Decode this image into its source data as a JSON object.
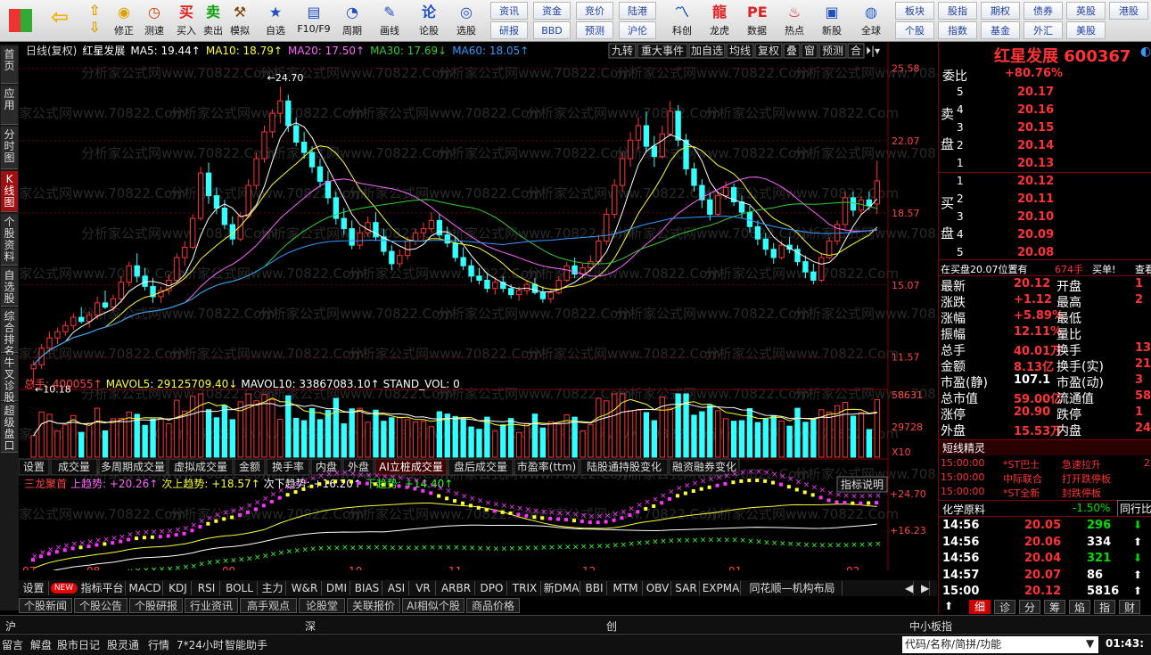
{
  "toolbar": {
    "buttons": [
      "修正",
      "测速",
      "买入",
      "卖出",
      "模拟",
      "自选",
      "F10/F9",
      "周期",
      "画线",
      "论股",
      "选股"
    ],
    "small_top": [
      "资讯",
      "资金",
      "竞价",
      "陆港"
    ],
    "small_bottom": [
      "研报",
      "BBD",
      "预测",
      "沪伦"
    ],
    "big": [
      "科创",
      "龙虎",
      "数据",
      "热点",
      "新股"
    ],
    "globe": "全球",
    "right_top": [
      "板块",
      "股指",
      "期权",
      "债券",
      "英股",
      "港股"
    ],
    "right_bottom": [
      "个股",
      "指数",
      "基金",
      "外汇",
      "美股"
    ]
  },
  "left_tabs": [
    "首页",
    "应用",
    "分时图",
    "K线图",
    "个股资料",
    "自选股",
    "综合排名",
    "牛叉诊股",
    "超级盘口"
  ],
  "main": {
    "header": {
      "period": "日线(复权)",
      "stock": "红星发展",
      "ma5": "MA5: 19.44↑",
      "ma10": "MA10: 18.79↑",
      "ma20": "MA20: 17.50↑",
      "ma30": "MA30: 17.69↓",
      "ma60": "MA60: 18.05↑"
    },
    "buttons": [
      "九转",
      "重大事件",
      "加自选",
      "均线",
      "复权",
      "叠",
      "窗",
      "预测",
      "合"
    ],
    "price_axis": [
      "25.58",
      "22.07",
      "18.57",
      "15.07",
      "11.57"
    ],
    "high_label": "24.70",
    "low_label": "10.18",
    "vol_header": {
      "total": "总手: 400055↑",
      "mavol5": "MAVOL5: 29125709.40↓",
      "mavol10": "MAVOL10: 33867083.10↑",
      "stand": "STAND_VOL: 0"
    },
    "vol_axis": [
      "58631",
      "29728",
      "X10"
    ],
    "vol_tabs": [
      "设置",
      "成交量",
      "多周期成交量",
      "虚拟成交量",
      "金额",
      "换手率",
      "内盘",
      "外盘",
      "AI立桩成交量",
      "盘后成交量",
      "市盈率(ttm)",
      "陆股通持股变化",
      "融资融券变化"
    ],
    "ind_header": {
      "name": "三龙聚首",
      "up": "上趋势: +20.26↑",
      "sub_up": "次上趋势: +18.57↑",
      "sub_down": "次下趋势: +16.20↑",
      "down": "下趋势: +14.40↑"
    },
    "ind_axis": [
      "+24.70",
      "+16.23"
    ],
    "ind_button": "指标说明",
    "months": [
      "07",
      "08",
      "09",
      "10",
      "11",
      "12",
      "01",
      "02"
    ]
  },
  "bottom_tabs": [
    "设置",
    "NEW",
    "指标平台",
    "MACD",
    "KDJ",
    "RSI",
    "BOLL",
    "主力",
    "W&R",
    "DMI",
    "BIAS",
    "ASI",
    "VR",
    "ARBR",
    "DPO",
    "TRIX",
    "新DMA",
    "BBI",
    "MTM",
    "OBV",
    "SAR",
    "EXPMA",
    "同花顺—机构布局"
  ],
  "news_tabs": [
    "个股新闻",
    "个股公告",
    "个股研报",
    "行业资讯",
    "高手观点",
    "论股堂",
    "关联报价",
    "AI相似个股",
    "商品价格"
  ],
  "market": [
    "沪",
    "深",
    "创",
    "中小板指"
  ],
  "status": {
    "items": [
      "留言",
      "解盘",
      "股市日记",
      "股灵通",
      "行情",
      "7*24小时",
      "智能助手"
    ],
    "search_placeholder": "代码/名称/简拼/功能",
    "time": "01:43:"
  },
  "quote": {
    "title": "红星发展 600367",
    "weibi_label": "委比",
    "weibi": "+80.76%",
    "sell_label": "卖盘",
    "buy_label": "买盘",
    "asks": [
      {
        "n": "5",
        "p": "20.17"
      },
      {
        "n": "4",
        "p": "20.16"
      },
      {
        "n": "3",
        "p": "20.15"
      },
      {
        "n": "2",
        "p": "20.14"
      },
      {
        "n": "1",
        "p": "20.13"
      }
    ],
    "bids": [
      {
        "n": "1",
        "p": "20.12"
      },
      {
        "n": "2",
        "p": "20.11"
      },
      {
        "n": "3",
        "p": "20.10"
      },
      {
        "n": "4",
        "p": "20.09"
      },
      {
        "n": "5",
        "p": "20.08"
      }
    ],
    "notice": "在买盘20.07位置有",
    "notice_amt": "674手",
    "notice_tag": "买单!",
    "notice_link": "查看",
    "stats": [
      {
        "l": "最新",
        "v": "20.12",
        "l2": "开盘",
        "v2": "1"
      },
      {
        "l": "涨跌",
        "v": "+1.12",
        "l2": "最高",
        "v2": "2"
      },
      {
        "l": "涨幅",
        "v": "+5.89%",
        "l2": "最低",
        "v2": ""
      },
      {
        "l": "振幅",
        "v": "12.11%",
        "l2": "量比",
        "v2": ""
      },
      {
        "l": "总手",
        "v": "40.01万",
        "l2": "换手",
        "v2": "13."
      },
      {
        "l": "金额",
        "v": "8.13亿",
        "l2": "换手(实)",
        "v2": "21."
      },
      {
        "l": "市盈(静)",
        "v": "107.1",
        "l2": "市盈(动)",
        "v2": "3"
      },
      {
        "l": "总市值",
        "v": "59.00亿",
        "l2": "流通值",
        "v2": "58.5"
      },
      {
        "l": "涨停",
        "v": "20.90",
        "l2": "跌停",
        "v2": "1"
      },
      {
        "l": "外盘",
        "v": "15.53万",
        "l2": "内盘",
        "v2": "24.4"
      }
    ],
    "short_title": "短线精灵",
    "short_items": [
      {
        "t": "15:00:00",
        "s": "*ST巴士",
        "e": "急速拉升",
        "x": "2"
      },
      {
        "t": "15:00:00",
        "s": "中际联合",
        "e": "打开跌停板",
        "x": ""
      },
      {
        "t": "15:00:00",
        "s": "*ST全新",
        "e": "封跌停板",
        "x": ""
      }
    ],
    "industry": "化学原料",
    "industry_chg": "-1.50%",
    "industry_link": "同行比比",
    "ticks": [
      {
        "t": "14:56",
        "p": "20.05",
        "v": "296",
        "d": "down"
      },
      {
        "t": "14:56",
        "p": "20.06",
        "v": "334",
        "d": "up"
      },
      {
        "t": "14:56",
        "p": "20.04",
        "v": "321",
        "d": "down"
      },
      {
        "t": "14:57",
        "p": "20.07",
        "v": "86",
        "d": "up"
      },
      {
        "t": "15:00",
        "p": "20.12",
        "v": "5816",
        "d": "up"
      }
    ],
    "bottom_tabs": [
      "细",
      "诊",
      "分",
      "筹",
      "焰",
      "指",
      "财"
    ]
  },
  "watermark": "分析家公式网www.70822.Com",
  "colors": {
    "up": "#ff3333",
    "down": "#33ffff",
    "ma5": "#ffffff",
    "ma10": "#ffff33",
    "ma20": "#ff66ff",
    "ma30": "#33cc33",
    "ma60": "#3399ff"
  },
  "chart_data": {
    "type": "candlestick",
    "candles": [
      [
        11.0,
        11.4,
        10.2,
        11.2
      ],
      [
        11.2,
        12.2,
        11.0,
        12.0
      ],
      [
        12.0,
        12.8,
        11.8,
        12.5
      ],
      [
        12.5,
        13.0,
        12.2,
        12.8
      ],
      [
        12.8,
        13.3,
        12.6,
        13.1
      ],
      [
        13.1,
        13.7,
        12.9,
        13.5
      ],
      [
        13.5,
        14.0,
        13.2,
        13.3
      ],
      [
        13.3,
        13.8,
        13.0,
        13.6
      ],
      [
        13.6,
        14.5,
        13.4,
        14.2
      ],
      [
        14.2,
        14.8,
        13.9,
        14.0
      ],
      [
        14.0,
        14.6,
        13.8,
        14.4
      ],
      [
        14.4,
        15.5,
        14.2,
        15.2
      ],
      [
        15.2,
        16.2,
        15.0,
        16.0
      ],
      [
        16.0,
        16.6,
        15.2,
        15.5
      ],
      [
        15.5,
        15.9,
        14.8,
        15.0
      ],
      [
        15.0,
        15.4,
        14.2,
        14.5
      ],
      [
        14.5,
        15.0,
        14.2,
        14.8
      ],
      [
        14.8,
        15.6,
        14.6,
        15.3
      ],
      [
        15.3,
        16.6,
        15.2,
        16.4
      ],
      [
        16.4,
        17.2,
        16.0,
        16.9
      ],
      [
        16.9,
        18.5,
        16.8,
        18.3
      ],
      [
        18.3,
        20.8,
        18.2,
        20.5
      ],
      [
        20.5,
        21.0,
        19.0,
        19.4
      ],
      [
        19.4,
        19.8,
        18.5,
        18.8
      ],
      [
        18.8,
        19.2,
        17.8,
        18.0
      ],
      [
        18.0,
        18.4,
        17.0,
        17.3
      ],
      [
        17.3,
        18.6,
        17.2,
        18.4
      ],
      [
        18.4,
        20.2,
        18.3,
        19.9
      ],
      [
        19.9,
        21.5,
        19.7,
        21.2
      ],
      [
        21.2,
        22.8,
        21.0,
        22.5
      ],
      [
        22.5,
        23.6,
        22.2,
        23.4
      ],
      [
        23.4,
        24.7,
        22.9,
        24.0
      ],
      [
        24.0,
        24.3,
        22.5,
        22.8
      ],
      [
        22.8,
        23.2,
        21.8,
        22.0
      ],
      [
        22.0,
        22.5,
        21.2,
        21.5
      ],
      [
        21.5,
        21.8,
        20.5,
        20.8
      ],
      [
        20.8,
        21.2,
        19.8,
        20.1
      ],
      [
        20.1,
        20.6,
        19.0,
        19.3
      ],
      [
        19.3,
        19.6,
        18.0,
        18.3
      ],
      [
        18.3,
        18.8,
        17.5,
        17.8
      ],
      [
        17.8,
        18.2,
        16.8,
        17.0
      ],
      [
        17.0,
        17.9,
        16.8,
        17.6
      ],
      [
        17.6,
        18.4,
        17.4,
        18.1
      ],
      [
        18.1,
        18.6,
        17.2,
        17.4
      ],
      [
        17.4,
        17.8,
        16.5,
        16.7
      ],
      [
        16.7,
        17.0,
        15.8,
        16.1
      ],
      [
        16.1,
        16.8,
        15.9,
        16.5
      ],
      [
        16.5,
        17.4,
        16.3,
        17.2
      ],
      [
        17.2,
        17.8,
        17.0,
        17.6
      ],
      [
        17.6,
        18.1,
        17.2,
        17.8
      ],
      [
        17.8,
        18.6,
        17.6,
        18.2
      ],
      [
        18.2,
        18.5,
        17.3,
        17.5
      ],
      [
        17.5,
        17.9,
        16.9,
        17.1
      ],
      [
        17.1,
        17.4,
        16.2,
        16.4
      ],
      [
        16.4,
        16.9,
        15.8,
        16.0
      ],
      [
        16.0,
        16.3,
        15.2,
        15.5
      ],
      [
        15.5,
        15.9,
        15.1,
        15.3
      ],
      [
        15.3,
        15.6,
        14.7,
        14.9
      ],
      [
        14.9,
        15.4,
        14.6,
        15.2
      ],
      [
        15.2,
        15.5,
        14.7,
        14.9
      ],
      [
        14.9,
        15.1,
        14.4,
        14.6
      ],
      [
        14.6,
        15.0,
        14.3,
        14.8
      ],
      [
        14.8,
        15.3,
        14.6,
        15.1
      ],
      [
        15.1,
        15.4,
        14.6,
        14.7
      ],
      [
        14.7,
        15.0,
        14.2,
        14.4
      ],
      [
        14.4,
        14.9,
        14.2,
        14.7
      ],
      [
        14.7,
        15.5,
        14.6,
        15.3
      ],
      [
        15.3,
        16.2,
        15.2,
        16.0
      ],
      [
        16.0,
        16.4,
        15.4,
        15.6
      ],
      [
        15.6,
        16.1,
        15.4,
        15.9
      ],
      [
        15.9,
        16.5,
        15.7,
        16.2
      ],
      [
        16.2,
        17.5,
        16.0,
        17.2
      ],
      [
        17.2,
        18.8,
        17.0,
        18.5
      ],
      [
        18.5,
        20.2,
        18.3,
        19.9
      ],
      [
        19.9,
        21.5,
        19.6,
        21.2
      ],
      [
        21.2,
        22.5,
        20.8,
        22.1
      ],
      [
        22.1,
        23.2,
        21.6,
        22.8
      ],
      [
        22.8,
        23.5,
        21.5,
        21.8
      ],
      [
        21.8,
        22.3,
        20.8,
        21.3
      ],
      [
        21.3,
        22.8,
        21.2,
        22.4
      ],
      [
        22.4,
        24.0,
        22.3,
        23.5
      ],
      [
        23.5,
        23.8,
        21.8,
        22.1
      ],
      [
        22.1,
        22.4,
        20.4,
        20.7
      ],
      [
        20.7,
        21.0,
        19.6,
        19.9
      ],
      [
        19.9,
        20.2,
        18.8,
        19.2
      ],
      [
        19.2,
        19.5,
        18.2,
        18.5
      ],
      [
        18.5,
        19.6,
        18.4,
        19.4
      ],
      [
        19.4,
        20.1,
        19.2,
        19.8
      ],
      [
        19.8,
        20.0,
        18.9,
        19.1
      ],
      [
        19.1,
        19.4,
        18.3,
        18.6
      ],
      [
        18.6,
        18.9,
        17.6,
        17.9
      ],
      [
        17.9,
        18.2,
        17.0,
        17.3
      ],
      [
        17.3,
        17.6,
        16.5,
        16.8
      ],
      [
        16.8,
        17.1,
        16.1,
        16.4
      ],
      [
        16.4,
        17.2,
        16.3,
        17.0
      ],
      [
        17.0,
        17.4,
        16.6,
        16.8
      ],
      [
        16.8,
        17.0,
        16.0,
        16.2
      ],
      [
        16.2,
        16.5,
        15.4,
        15.7
      ],
      [
        15.7,
        16.1,
        15.1,
        15.3
      ],
      [
        15.3,
        16.6,
        15.2,
        16.4
      ],
      [
        16.4,
        17.4,
        16.3,
        17.2
      ],
      [
        17.2,
        18.2,
        17.0,
        18.0
      ],
      [
        18.0,
        19.6,
        17.8,
        19.3
      ],
      [
        19.3,
        19.6,
        18.4,
        18.7
      ],
      [
        18.7,
        19.4,
        18.5,
        19.2
      ],
      [
        19.2,
        19.6,
        18.7,
        18.9
      ],
      [
        19.0,
        21.1,
        18.5,
        20.12
      ]
    ],
    "price_range": [
      10.0,
      26.0
    ],
    "price_ticks": [
      25.58,
      22.07,
      18.57,
      15.07,
      11.57
    ],
    "vol_max": 58631,
    "ind_range": [
      10,
      26
    ]
  }
}
